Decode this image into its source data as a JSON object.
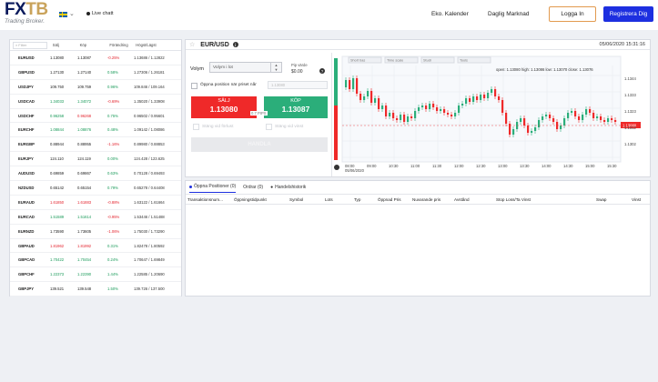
{
  "header": {
    "logo_main": "FXTB",
    "logo_sub": "Trading Broker.",
    "language_flag": "sweden-flag",
    "live_chat": "Live chatt",
    "nav": [
      "Eko. Kalender",
      "Daglig Marknad"
    ],
    "login": "Logga In",
    "register": "Registrera Dig"
  },
  "watchlist": {
    "search_placeholder": "Filter",
    "columns": [
      "Sälj",
      "Köp",
      "Förändring",
      "Högst/Lägst"
    ],
    "rows": [
      {
        "symbol": "EURUSD",
        "bid": "1.13080",
        "ask": "1.13087",
        "change": "-0.25%",
        "dir": "dn",
        "high_low": "1.13686 / 1.12822",
        "bid_dir": "",
        "ask_dir": ""
      },
      {
        "symbol": "GBPUSD",
        "bid": "1.27130",
        "ask": "1.27140",
        "change": "0.58%",
        "dir": "up",
        "high_low": "1.27306 / 1.26181",
        "bid_dir": "",
        "ask_dir": ""
      },
      {
        "symbol": "USDJPY",
        "bid": "109.750",
        "ask": "109.759",
        "change": "0.96%",
        "dir": "up",
        "high_low": "109.846 / 109.164",
        "bid_dir": "",
        "ask_dir": ""
      },
      {
        "symbol": "USDCAD",
        "bid": "1.34033",
        "ask": "1.34072",
        "change": "-0.69%",
        "dir": "dn",
        "high_low": "1.35020 / 1.33908",
        "bid_dir": "up",
        "ask_dir": "up"
      },
      {
        "symbol": "USDCHF",
        "bid": "0.96258",
        "ask": "0.96268",
        "change": "0.75%",
        "dir": "up",
        "high_low": "0.96502 / 0.95601",
        "bid_dir": "up",
        "ask_dir": "dn"
      },
      {
        "symbol": "EURCHF",
        "bid": "1.08844",
        "ask": "1.08876",
        "change": "0.48%",
        "dir": "up",
        "high_low": "1.09142 / 1.08086",
        "bid_dir": "up",
        "ask_dir": "up"
      },
      {
        "symbol": "EURGBP",
        "bid": "0.88944",
        "ask": "0.88955",
        "change": "-1.16%",
        "dir": "dn",
        "high_low": "0.89980 / 0.88853",
        "bid_dir": "",
        "ask_dir": ""
      },
      {
        "symbol": "EURJPY",
        "bid": "124.110",
        "ask": "124.119",
        "change": "0.00%",
        "dir": "up",
        "high_low": "124.428 / 123.625",
        "bid_dir": "",
        "ask_dir": ""
      },
      {
        "symbol": "AUDUSD",
        "bid": "0.69859",
        "ask": "0.69867",
        "change": "0.63%",
        "dir": "up",
        "high_low": "0.70128 / 0.69493",
        "bid_dir": "",
        "ask_dir": ""
      },
      {
        "symbol": "NZDUSD",
        "bid": "0.65142",
        "ask": "0.65154",
        "change": "0.79%",
        "dir": "up",
        "high_low": "0.65278 / 0.64408",
        "bid_dir": "",
        "ask_dir": ""
      },
      {
        "symbol": "EURAUD",
        "bid": "1.61850",
        "ask": "1.61883",
        "change": "-0.88%",
        "dir": "dn",
        "high_low": "1.63122 / 1.61664",
        "bid_dir": "dn",
        "ask_dir": "dn"
      },
      {
        "symbol": "EURCAD",
        "bid": "1.51589",
        "ask": "1.51614",
        "change": "-0.95%",
        "dir": "dn",
        "high_low": "1.53446 / 1.51488",
        "bid_dir": "up",
        "ask_dir": "up"
      },
      {
        "symbol": "EURNZD",
        "bid": "1.73590",
        "ask": "1.73605",
        "change": "-1.06%",
        "dir": "dn",
        "high_low": "1.75030 / 1.73290",
        "bid_dir": "",
        "ask_dir": ""
      },
      {
        "symbol": "GBPAUD",
        "bid": "1.81962",
        "ask": "1.81992",
        "change": "0.31%",
        "dir": "up",
        "high_low": "1.82478 / 1.80592",
        "bid_dir": "dn",
        "ask_dir": "dn"
      },
      {
        "symbol": "GBPCAD",
        "bid": "1.70422",
        "ask": "1.70454",
        "change": "0.24%",
        "dir": "up",
        "high_low": "1.70647 / 1.69849",
        "bid_dir": "up",
        "ask_dir": "up"
      },
      {
        "symbol": "GBPCHF",
        "bid": "1.22373",
        "ask": "1.22390",
        "change": "1.44%",
        "dir": "up",
        "high_low": "1.22585 / 1.20690",
        "bid_dir": "up",
        "ask_dir": "up"
      },
      {
        "symbol": "GBPJPY",
        "bid": "139.521",
        "ask": "139.548",
        "change": "1.50%",
        "dir": "up",
        "high_low": "139.726 / 137.500",
        "bid_dir": "",
        "ask_dir": ""
      }
    ]
  },
  "trade": {
    "symbol": "EUR/USD",
    "datetime": "05/06/2020 15:31:16",
    "volume_label": "Volym",
    "volume_placeholder": "Volym i lot",
    "pip_label": "Pip värde",
    "pip_value": "$0.00",
    "open_at_price_label": "Öppna position när priset når",
    "price_placeholder": "1.13080",
    "sell_label": "SÄLJ",
    "sell_price": "1.13080",
    "buy_label": "KÖP",
    "buy_price": "1.13087",
    "spread": "0.7 PIPS",
    "stop_loss_label": "Stäng vid förlust",
    "take_profit_label": "Stäng vid vinst",
    "action_button": "HANDLA"
  },
  "chart": {
    "toolbar": [
      "Short bas",
      "Time scale",
      "Studi",
      "Tools"
    ],
    "ohlc_text": "open: 1.13080 high: 1.13086 low: 1.13070 close: 1.13076",
    "current_price_tag": "1.13080",
    "y_labels": [
      "1.1344",
      "1.1333",
      "1.1323",
      "1.1312",
      "1.1302"
    ],
    "x_labels": [
      "08:00",
      "09:00",
      "10:30",
      "11:00",
      "11:30",
      "12:00",
      "12:30",
      "13:00",
      "13:30",
      "14:00",
      "14:30",
      "15:00",
      "15:30"
    ],
    "x_first_date": "05/06/2020",
    "watermark_icon": "chart-settings-icon"
  },
  "orders": {
    "tabs": [
      "Öppna Positioner (0)",
      "Ordrar (0)",
      "Handelshistorik"
    ],
    "columns": [
      "Transaktionsnum...",
      "Öppningstidpunkt",
      "Symbol",
      "Lots",
      "Typ",
      "Öppnad Pris",
      "Nuvarande pris",
      "Avstånd",
      "Stop Loss/Ta Vinst",
      "Swap",
      "Vinst"
    ]
  },
  "colors": {
    "brand_navy": "#0a1a5c",
    "brand_gold": "#c9a35b",
    "sell": "#ef2929",
    "buy": "#2bae7a",
    "register": "#1d2fe0",
    "login_border": "#e29a4f"
  }
}
